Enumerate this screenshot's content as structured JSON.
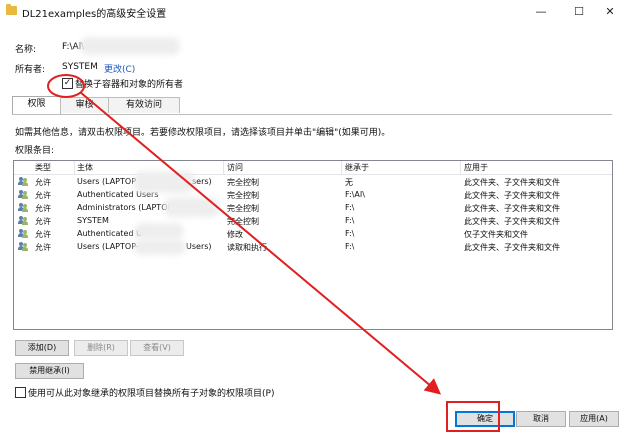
{
  "window": {
    "title": "DL21examples的高级安全设置",
    "minimize_glyph": "—",
    "maximize_glyph": "☐",
    "close_glyph": "✕"
  },
  "info": {
    "name_label": "名称:",
    "name_value": "F:\\Al\\",
    "owner_label": "所有者:",
    "owner_value": "SYSTEM",
    "change_link": "更改(C)",
    "replace_owner_label": "替换子容器和对象的所有者",
    "replace_owner_checked": true
  },
  "tabs": [
    {
      "label": "权限",
      "active": true
    },
    {
      "label": "审核",
      "active": false
    },
    {
      "label": "有效访问",
      "active": false
    }
  ],
  "instructions": "如需其他信息，请双击权限项目。若要修改权限项目，请选择该项目并单击\"编辑\"(如果可用)。",
  "entries_label": "权限条目:",
  "table": {
    "headers": [
      "类型",
      "主体",
      "访问",
      "继承于",
      "应用于"
    ],
    "rows": [
      {
        "type": "允许",
        "principal": "Users (LAPTOP",
        "principal_tail": "sers)",
        "access": "完全控制",
        "inherited": "无",
        "applies": "此文件夹、子文件夹和文件"
      },
      {
        "type": "允许",
        "principal": "Authenticated Users",
        "principal_tail": "",
        "access": "完全控制",
        "inherited": "F:\\AI\\",
        "applies": "此文件夹、子文件夹和文件"
      },
      {
        "type": "允许",
        "principal": "Administrators (LAPTOP",
        "principal_tail": "",
        "access": "完全控制",
        "inherited": "F:\\",
        "applies": "此文件夹、子文件夹和文件"
      },
      {
        "type": "允许",
        "principal": "SYSTEM",
        "principal_tail": "",
        "access": "完全控制",
        "inherited": "F:\\",
        "applies": "此文件夹、子文件夹和文件"
      },
      {
        "type": "允许",
        "principal": "Authenticated U",
        "principal_tail": "",
        "access": "修改",
        "inherited": "F:\\",
        "applies": "仅子文件夹和文件"
      },
      {
        "type": "允许",
        "principal": "Users (LAPTOP-",
        "principal_tail": "Users)",
        "access": "读取和执行",
        "inherited": "F:\\",
        "applies": "此文件夹、子文件夹和文件"
      }
    ]
  },
  "buttons": {
    "add": "添加(D)",
    "remove": "删除(R)",
    "view": "查看(V)",
    "disable_inheritance": "禁用继承(I)",
    "ok": "确定",
    "cancel": "取消",
    "apply": "应用(A)"
  },
  "replace_child": {
    "label": "使用可从此对象继承的权限项目替换所有子对象的权限项目(P)",
    "checked": false
  },
  "annotation_color": "#e02020"
}
